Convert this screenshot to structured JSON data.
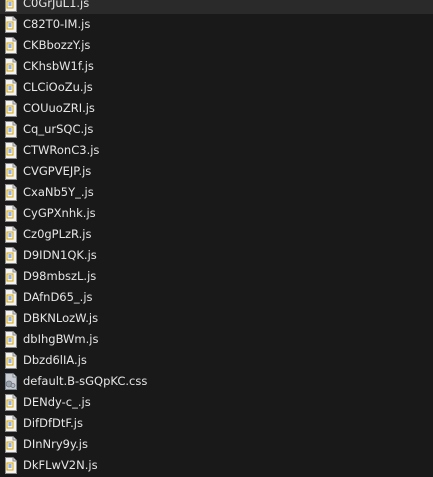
{
  "files": [
    {
      "name": "C0GrJuL1.js",
      "type": "js",
      "icon": "javascript-file-icon"
    },
    {
      "name": "C82T0-IM.js",
      "type": "js",
      "icon": "javascript-file-icon"
    },
    {
      "name": "CKBbozzY.js",
      "type": "js",
      "icon": "javascript-file-icon"
    },
    {
      "name": "CKhsbW1f.js",
      "type": "js",
      "icon": "javascript-file-icon"
    },
    {
      "name": "CLCiOoZu.js",
      "type": "js",
      "icon": "javascript-file-icon"
    },
    {
      "name": "COUuoZRI.js",
      "type": "js",
      "icon": "javascript-file-icon"
    },
    {
      "name": "Cq_urSQC.js",
      "type": "js",
      "icon": "javascript-file-icon"
    },
    {
      "name": "CTWRonC3.js",
      "type": "js",
      "icon": "javascript-file-icon"
    },
    {
      "name": "CVGPVEJP.js",
      "type": "js",
      "icon": "javascript-file-icon"
    },
    {
      "name": "CxaNb5Y_.js",
      "type": "js",
      "icon": "javascript-file-icon"
    },
    {
      "name": "CyGPXnhk.js",
      "type": "js",
      "icon": "javascript-file-icon"
    },
    {
      "name": "Cz0gPLzR.js",
      "type": "js",
      "icon": "javascript-file-icon"
    },
    {
      "name": "D9IDN1QK.js",
      "type": "js",
      "icon": "javascript-file-icon"
    },
    {
      "name": "D98mbszL.js",
      "type": "js",
      "icon": "javascript-file-icon"
    },
    {
      "name": "DAfnD65_.js",
      "type": "js",
      "icon": "javascript-file-icon"
    },
    {
      "name": "DBKNLozW.js",
      "type": "js",
      "icon": "javascript-file-icon"
    },
    {
      "name": "dbIhgBWm.js",
      "type": "js",
      "icon": "javascript-file-icon"
    },
    {
      "name": "Dbzd6lIA.js",
      "type": "js",
      "icon": "javascript-file-icon"
    },
    {
      "name": "default.B-sGQpKC.css",
      "type": "css",
      "icon": "css-file-icon"
    },
    {
      "name": "DENdy-c_.js",
      "type": "js",
      "icon": "javascript-file-icon"
    },
    {
      "name": "DifDfDtF.js",
      "type": "js",
      "icon": "javascript-file-icon"
    },
    {
      "name": "DInNry9y.js",
      "type": "js",
      "icon": "javascript-file-icon"
    },
    {
      "name": "DkFLwV2N.js",
      "type": "js",
      "icon": "javascript-file-icon"
    }
  ],
  "colors": {
    "background": "#191919",
    "text": "#e6e6e6",
    "js_icon_fill": "#f3f3f3",
    "js_icon_stroke": "#8a8a8a",
    "js_icon_accent": "#d9a800",
    "css_icon_fill": "#c9cdd3"
  }
}
